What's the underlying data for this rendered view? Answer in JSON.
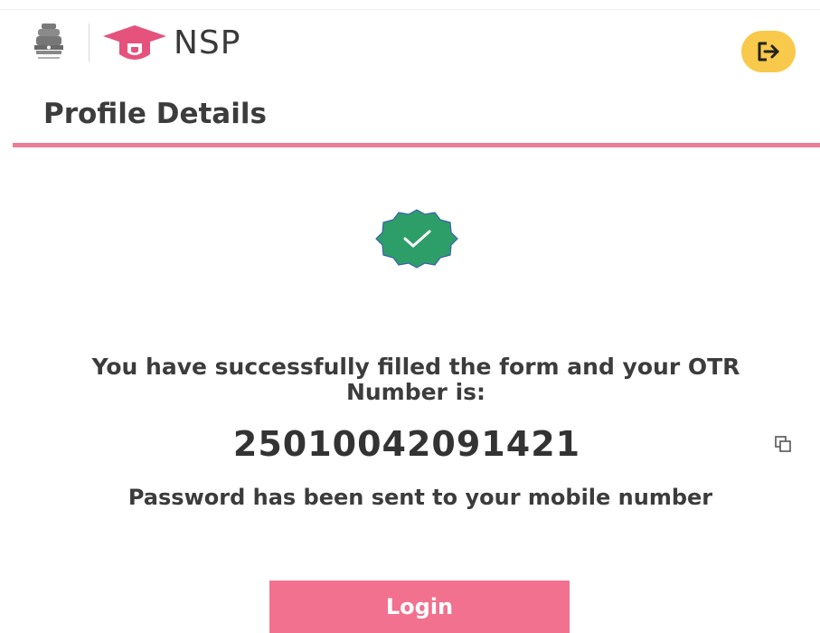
{
  "header": {
    "brand": "NSP",
    "accent_color": "#e5527b",
    "logout_icon": "logout-icon",
    "logout_color": "#f8c94a"
  },
  "page": {
    "title": "Profile Details",
    "underline_color": "#ec7d98"
  },
  "success": {
    "icon": "check-badge-icon",
    "icon_color": "#2e9e68",
    "message": "You have successfully filled the form and your OTR Number is:",
    "otr_number": "25010042091421",
    "copy_icon": "copy-icon",
    "password_note": "Password has been sent to your mobile number"
  },
  "actions": {
    "login_label": "Login",
    "login_color": "#f2718e"
  }
}
